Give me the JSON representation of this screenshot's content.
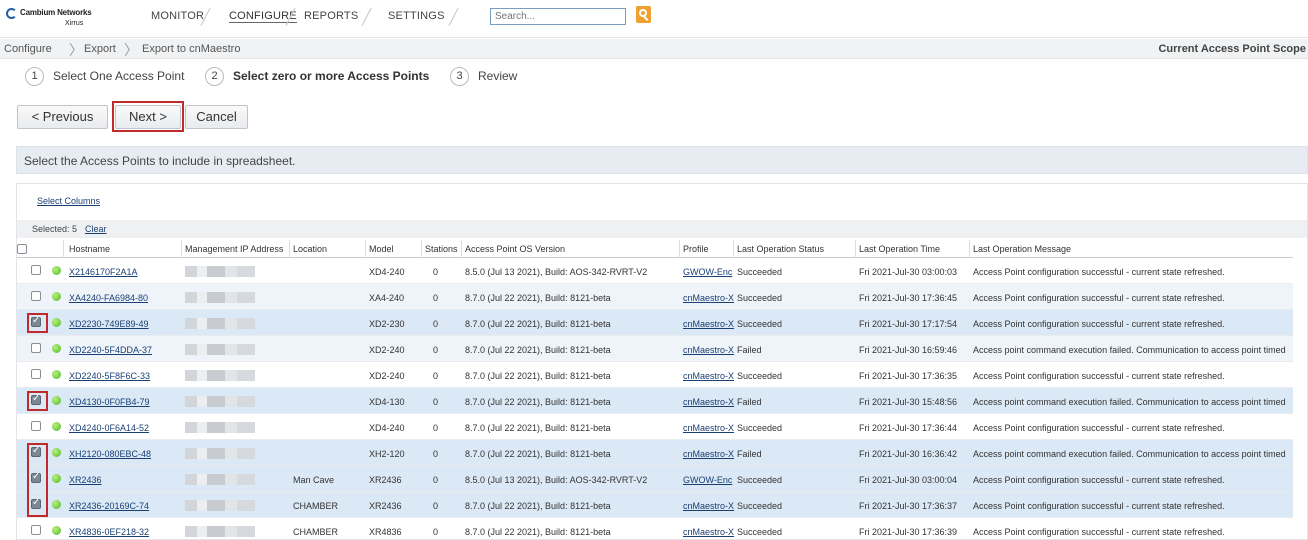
{
  "header": {
    "brand": "Cambium Networks",
    "brand_sub": "Xirrus",
    "nav": [
      "MONITOR",
      "CONFIGURE",
      "REPORTS",
      "SETTINGS"
    ],
    "search_placeholder": "Search..."
  },
  "breadcrumb": [
    "Configure",
    "Export",
    "Export to cnMaestro"
  ],
  "scope": "Current Access Point Scope",
  "steps": [
    {
      "num": "1",
      "label": "Select One Access Point"
    },
    {
      "num": "2",
      "label": "Select zero or more Access Points"
    },
    {
      "num": "3",
      "label": "Review"
    }
  ],
  "buttons": {
    "previous": "< Previous",
    "next": "Next >",
    "cancel": "Cancel"
  },
  "instruction": "Select the Access Points to include in spreadsheet.",
  "table": {
    "select_columns": "Select Columns",
    "selected_label": "Selected: 5",
    "clear": "Clear",
    "headers": [
      "Hostname",
      "Management IP Address",
      "Location",
      "Model",
      "Stations",
      "Access Point OS Version",
      "Profile",
      "Last Operation Status",
      "Last Operation Time",
      "Last Operation Message"
    ],
    "rows": [
      {
        "checked": false,
        "hostname": "X2146170F2A1A",
        "location": "",
        "model": "XD4-240",
        "stations": "0",
        "os": "8.5.0 (Jul 13 2021), Build: AOS-342-RVRT-V2",
        "profile": "GWOW-Enc",
        "status": "Succeeded",
        "time": "Fri 2021-Jul-30 03:00:03",
        "message": "Access Point configuration successful - current state refreshed."
      },
      {
        "checked": false,
        "hostname": "XA4240-FA6984-80",
        "location": "",
        "model": "XA4-240",
        "stations": "0",
        "os": "8.7.0 (Jul 22 2021), Build: 8121-beta",
        "profile": "cnMaestro-X",
        "status": "Succeeded",
        "time": "Fri 2021-Jul-30 17:36:45",
        "message": "Access Point configuration successful - current state refreshed."
      },
      {
        "checked": true,
        "hostname": "XD2230-749E89-49",
        "location": "",
        "model": "XD2-230",
        "stations": "0",
        "os": "8.7.0 (Jul 22 2021), Build: 8121-beta",
        "profile": "cnMaestro-X",
        "status": "Succeeded",
        "time": "Fri 2021-Jul-30 17:17:54",
        "message": "Access Point configuration successful - current state refreshed."
      },
      {
        "checked": false,
        "hostname": "XD2240-5F4DDA-37",
        "location": "",
        "model": "XD2-240",
        "stations": "0",
        "os": "8.7.0 (Jul 22 2021), Build: 8121-beta",
        "profile": "cnMaestro-X",
        "status": "Failed",
        "time": "Fri 2021-Jul-30 16:59:46",
        "message": "Access point command execution failed. Communication to access point timed"
      },
      {
        "checked": false,
        "hostname": "XD2240-5F8F6C-33",
        "location": "",
        "model": "XD2-240",
        "stations": "0",
        "os": "8.7.0 (Jul 22 2021), Build: 8121-beta",
        "profile": "cnMaestro-X",
        "status": "Succeeded",
        "time": "Fri 2021-Jul-30 17:36:35",
        "message": "Access Point configuration successful - current state refreshed."
      },
      {
        "checked": true,
        "hostname": "XD4130-0F0FB4-79",
        "location": "",
        "model": "XD4-130",
        "stations": "0",
        "os": "8.7.0 (Jul 22 2021), Build: 8121-beta",
        "profile": "cnMaestro-X",
        "status": "Failed",
        "time": "Fri 2021-Jul-30 15:48:56",
        "message": "Access point command execution failed. Communication to access point timed"
      },
      {
        "checked": false,
        "hostname": "XD4240-0F6A14-52",
        "location": "",
        "model": "XD4-240",
        "stations": "0",
        "os": "8.7.0 (Jul 22 2021), Build: 8121-beta",
        "profile": "cnMaestro-X",
        "status": "Succeeded",
        "time": "Fri 2021-Jul-30 17:36:44",
        "message": "Access Point configuration successful - current state refreshed."
      },
      {
        "checked": true,
        "hostname": "XH2120-080EBC-48",
        "location": "",
        "model": "XH2-120",
        "stations": "0",
        "os": "8.7.0 (Jul 22 2021), Build: 8121-beta",
        "profile": "cnMaestro-X",
        "status": "Failed",
        "time": "Fri 2021-Jul-30 16:36:42",
        "message": "Access point command execution failed. Communication to access point timed"
      },
      {
        "checked": true,
        "hostname": "XR2436",
        "location": "Man Cave",
        "model": "XR2436",
        "stations": "0",
        "os": "8.5.0 (Jul 13 2021), Build: AOS-342-RVRT-V2",
        "profile": "GWOW-Enc",
        "status": "Succeeded",
        "time": "Fri 2021-Jul-30 03:00:04",
        "message": "Access Point configuration successful - current state refreshed."
      },
      {
        "checked": true,
        "hostname": "XR2436-20169C-74",
        "location": "CHAMBER",
        "model": "XR2436",
        "stations": "0",
        "os": "8.7.0 (Jul 22 2021), Build: 8121-beta",
        "profile": "cnMaestro-X",
        "status": "Succeeded",
        "time": "Fri 2021-Jul-30 17:36:37",
        "message": "Access Point configuration successful - current state refreshed."
      },
      {
        "checked": false,
        "hostname": "XR4836-0EF218-32",
        "location": "CHAMBER",
        "model": "XR4836",
        "stations": "0",
        "os": "8.7.0 (Jul 22 2021), Build: 8121-beta",
        "profile": "cnMaestro-X",
        "status": "Succeeded",
        "time": "Fri 2021-Jul-30 17:36:39",
        "message": "Access Point configuration successful - current state refreshed."
      }
    ]
  }
}
